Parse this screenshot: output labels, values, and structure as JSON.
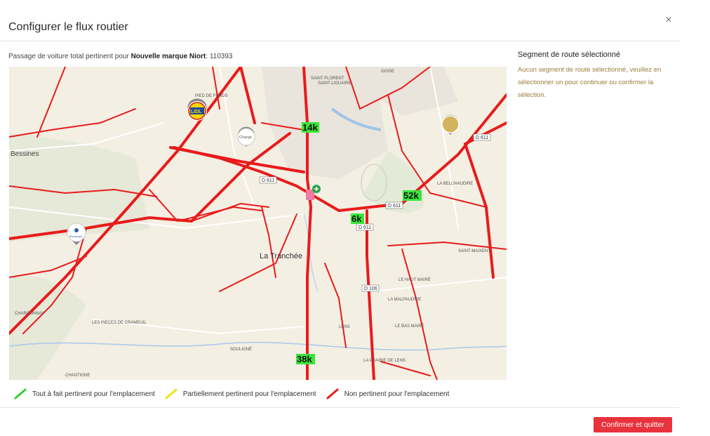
{
  "dialog": {
    "title": "Configurer le flux routier",
    "close_glyph": "×"
  },
  "summary": {
    "prefix": "Passage de voiture total pertinent pour",
    "brand": "Nouvelle marque Niort",
    "separator": ":",
    "total": "110393"
  },
  "side_panel": {
    "title": "Segment de route sélectionné",
    "message": "Aucun segment de route sélectionné, veuillez en sélectionner un pour continuer ou confirmer la sélection."
  },
  "map": {
    "traffic_labels": [
      "14k",
      "52k",
      "6k",
      "38k"
    ],
    "places": [
      "La Tranchée",
      "Bessines",
      "SAINT-LIGUAIRE",
      "PIED DE FONDS",
      "LA BELLIVAUDIRE",
      "LE HAUT MAIRÉ",
      "LA MALPAUDRIE",
      "LE BAS MAIRÉ",
      "CHARCONNAY",
      "LES PIÈCES DE CRAMEUIL",
      "SOULIGNÉ",
      "CHANTIGNE",
      "LA PRAIRIE DE LENS",
      "LENS",
      "SAINT-MAIXENT",
      "GOISE",
      "SAINT-FLORENT"
    ],
    "road_codes": [
      "D 611",
      "D 611",
      "D 611",
      "D 106",
      "D 611"
    ],
    "pins": [
      "lidl-pin",
      "charge-pin",
      "store-pin",
      "boulanger-pin",
      "hospital-icon"
    ],
    "pin_texts": [
      "LIDL",
      "Charge",
      "Boulanger"
    ]
  },
  "legend": {
    "items": [
      {
        "label": "Tout à fait pertinent pour l'emplacement",
        "color": "#2fd12f"
      },
      {
        "label": "Partiellement pertinent pour l'emplacement",
        "color": "#f5e11b"
      },
      {
        "label": "Non pertinent pour l'emplacement",
        "color": "#e81b1b"
      }
    ]
  },
  "footer": {
    "confirm_label": "Confirmer et quitter"
  },
  "colors": {
    "accent": "#e8323c",
    "relevant": "#2fd12f",
    "partial": "#f5e11b",
    "irrelevant": "#e81b1b"
  }
}
